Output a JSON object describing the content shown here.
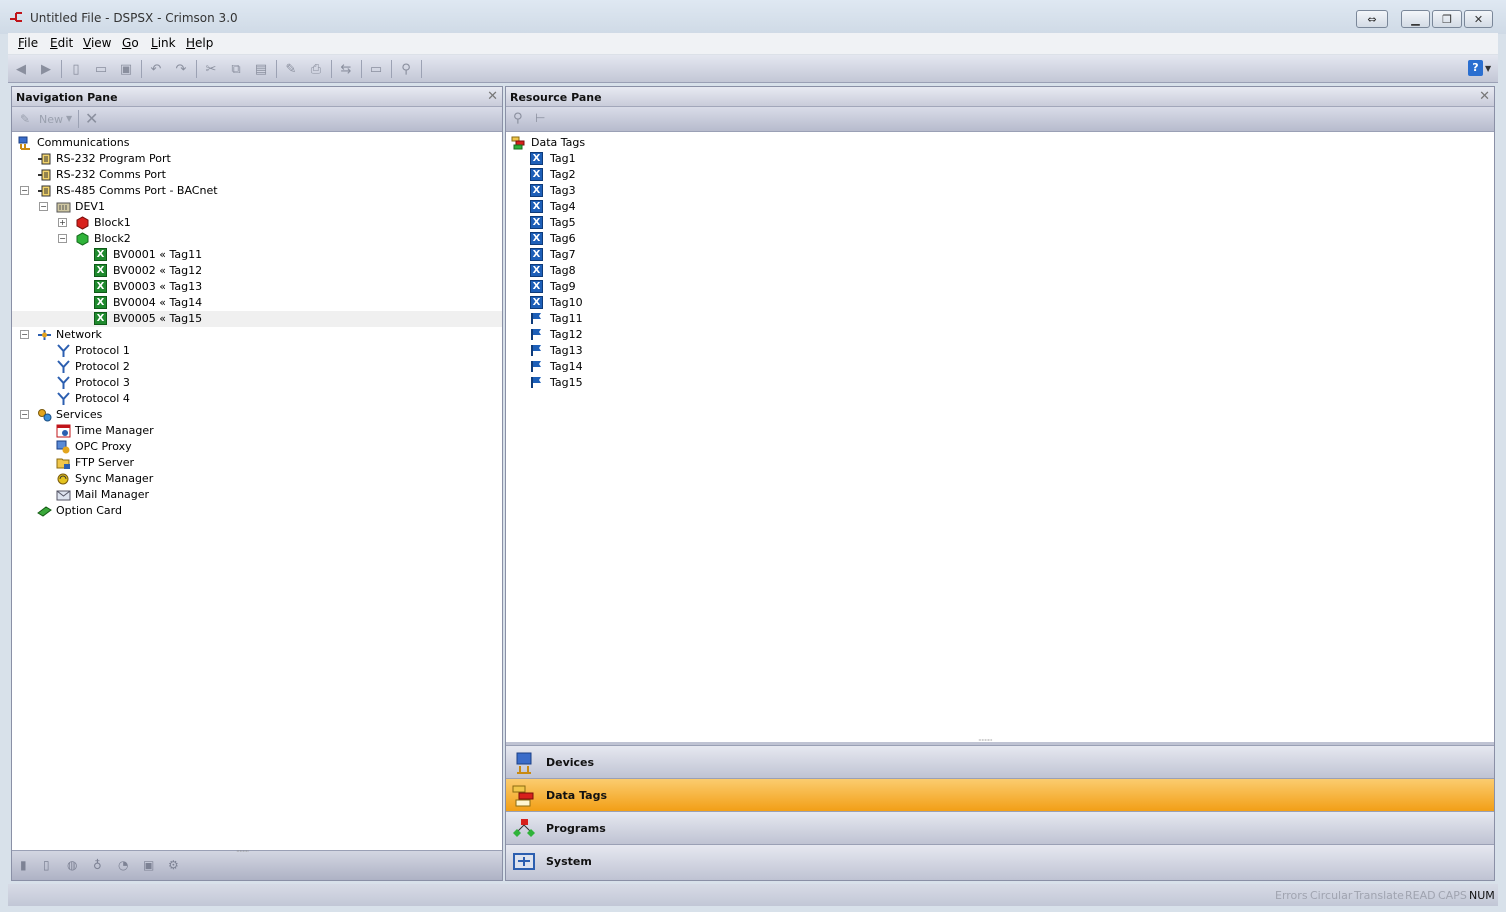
{
  "window": {
    "title": "Untitled File - DSPSX - Crimson 3.0"
  },
  "menu": [
    {
      "label": "File",
      "key": "F",
      "rest": "ile"
    },
    {
      "label": "Edit",
      "key": "E",
      "rest": "dit"
    },
    {
      "label": "View",
      "key": "V",
      "rest": "iew"
    },
    {
      "label": "Go",
      "key": "G",
      "rest": "o"
    },
    {
      "label": "Link",
      "key": "L",
      "rest": "ink"
    },
    {
      "label": "Help",
      "key": "H",
      "rest": "elp"
    }
  ],
  "nav_pane": {
    "title": "Navigation Pane",
    "new_label": "New",
    "tree": [
      {
        "label": "Communications",
        "icon": "communications-icon"
      },
      {
        "label": "RS-232 Program Port",
        "icon": "port-icon"
      },
      {
        "label": "RS-232 Comms Port",
        "icon": "port-icon"
      },
      {
        "label": "RS-485 Comms Port - BACnet",
        "icon": "port-icon"
      },
      {
        "label": "DEV1",
        "icon": "device-icon"
      },
      {
        "label": "Block1",
        "icon": "red-block-icon"
      },
      {
        "label": "Block2",
        "icon": "green-block-icon"
      },
      {
        "label": "BV0001 « Tag11",
        "icon": "mapped-tag-icon"
      },
      {
        "label": "BV0002 « Tag12",
        "icon": "mapped-tag-icon"
      },
      {
        "label": "BV0003 « Tag13",
        "icon": "mapped-tag-icon"
      },
      {
        "label": "BV0004 « Tag14",
        "icon": "mapped-tag-icon"
      },
      {
        "label": "BV0005 « Tag15",
        "icon": "mapped-tag-icon"
      },
      {
        "label": "Network",
        "icon": "network-icon"
      },
      {
        "label": "Protocol 1",
        "icon": "protocol-icon"
      },
      {
        "label": "Protocol 2",
        "icon": "protocol-icon"
      },
      {
        "label": "Protocol 3",
        "icon": "protocol-icon"
      },
      {
        "label": "Protocol 4",
        "icon": "protocol-icon"
      },
      {
        "label": "Services",
        "icon": "services-icon"
      },
      {
        "label": "Time Manager",
        "icon": "time-manager-icon"
      },
      {
        "label": "OPC Proxy",
        "icon": "opc-proxy-icon"
      },
      {
        "label": "FTP Server",
        "icon": "ftp-server-icon"
      },
      {
        "label": "Sync Manager",
        "icon": "sync-manager-icon"
      },
      {
        "label": "Mail Manager",
        "icon": "mail-manager-icon"
      },
      {
        "label": "Option Card",
        "icon": "option-card-icon"
      }
    ]
  },
  "res_pane": {
    "title": "Resource Pane",
    "root": "Data Tags",
    "tags": [
      "Tag1",
      "Tag2",
      "Tag3",
      "Tag4",
      "Tag5",
      "Tag6",
      "Tag7",
      "Tag8",
      "Tag9",
      "Tag10",
      "Tag11",
      "Tag12",
      "Tag13",
      "Tag14",
      "Tag15"
    ]
  },
  "categories": [
    {
      "label": "Devices",
      "icon": "devices-icon"
    },
    {
      "label": "Data Tags",
      "icon": "data-tags-icon",
      "active": true
    },
    {
      "label": "Programs",
      "icon": "programs-icon"
    },
    {
      "label": "System",
      "icon": "system-icon"
    }
  ],
  "status": [
    {
      "label": "Errors",
      "on": false
    },
    {
      "label": "Circular",
      "on": false
    },
    {
      "label": "Translate",
      "on": false
    },
    {
      "label": "READ",
      "on": false
    },
    {
      "label": "CAPS",
      "on": false
    },
    {
      "label": "NUM",
      "on": true
    }
  ],
  "colors": {
    "accent_active": "#f29f16",
    "tag_green": "#1f8a2e",
    "tag_blue": "#1d5fb8"
  }
}
